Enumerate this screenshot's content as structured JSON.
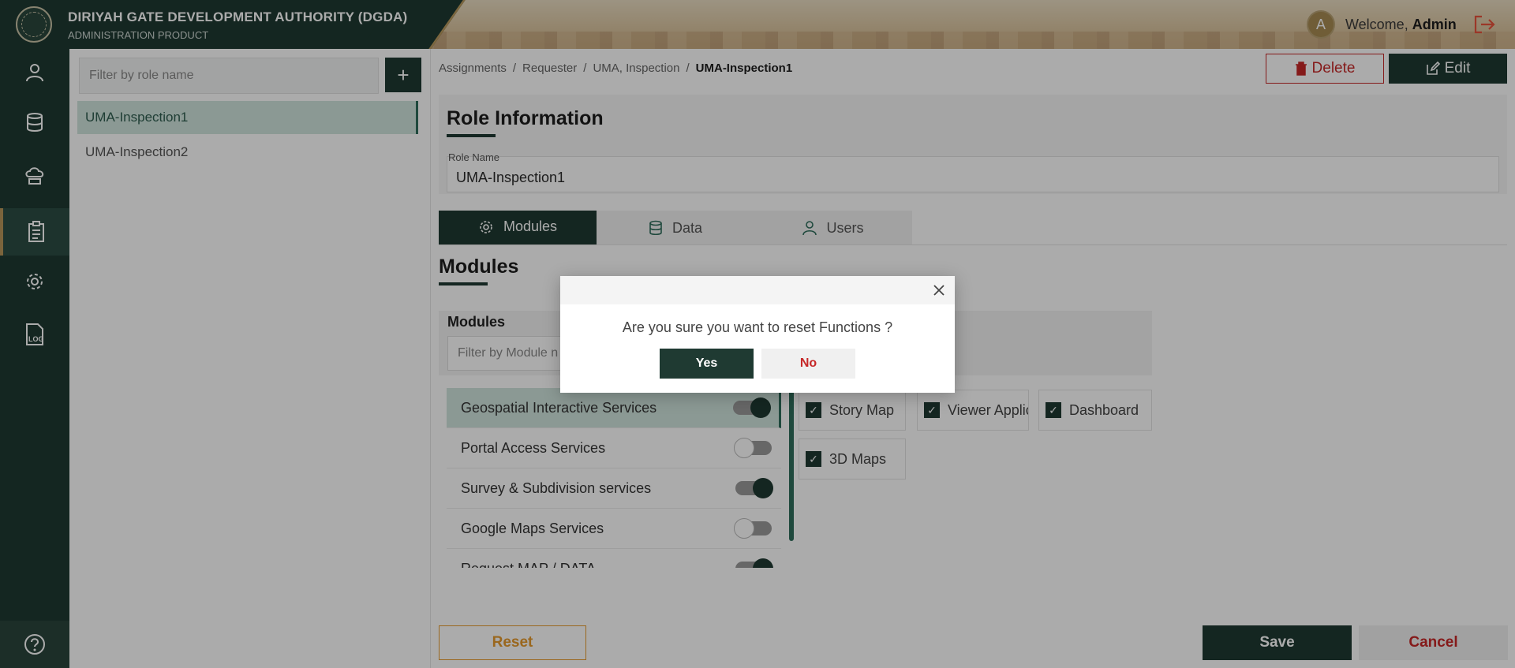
{
  "header": {
    "org_title": "DIRIYAH GATE DEVELOPMENT AUTHORITY (DGDA)",
    "org_subtitle": "ADMINISTRATION PRODUCT",
    "avatar_letter": "A",
    "welcome_prefix": "Welcome,",
    "welcome_user": "Admin"
  },
  "rail": {
    "items": [
      "user-icon",
      "database-icon",
      "cloud-icon",
      "clipboard-icon",
      "gear-icon",
      "log-icon"
    ],
    "active_index": 3,
    "help_icon": "help-icon"
  },
  "roles": {
    "filter_placeholder": "Filter by role name",
    "add_label": "+",
    "items": [
      "UMA-Inspection1",
      "UMA-Inspection2"
    ],
    "selected": "UMA-Inspection1"
  },
  "breadcrumb": [
    "Assignments",
    "Requester",
    "UMA, Inspection",
    "UMA-Inspection1"
  ],
  "actions": {
    "delete": "Delete",
    "edit": "Edit"
  },
  "role_info": {
    "title": "Role Information",
    "role_name_label": "Role Name",
    "role_name_value": "UMA-Inspection1"
  },
  "tabs": [
    {
      "label": "Modules",
      "icon": "gear-icon",
      "active": true
    },
    {
      "label": "Data",
      "icon": "database-icon",
      "active": false
    },
    {
      "label": "Users",
      "icon": "user-icon",
      "active": false
    }
  ],
  "modules_section": {
    "title": "Modules",
    "list_header": "Modules",
    "filter_placeholder": "Filter by Module n",
    "items": [
      {
        "label": "Geospatial Interactive Services",
        "on": true,
        "selected": true
      },
      {
        "label": "Portal Access Services",
        "on": false,
        "selected": false
      },
      {
        "label": "Survey & Subdivision services",
        "on": true,
        "selected": false
      },
      {
        "label": "Google Maps Services",
        "on": false,
        "selected": false
      },
      {
        "label": "Request MAP / DATA",
        "on": true,
        "selected": false
      }
    ]
  },
  "functions": [
    {
      "label": "Story Map",
      "checked": true
    },
    {
      "label": "Viewer Application",
      "checked": true
    },
    {
      "label": "Dashboard",
      "checked": true
    },
    {
      "label": "3D Maps",
      "checked": true
    }
  ],
  "footer": {
    "reset": "Reset",
    "save": "Save",
    "cancel": "Cancel"
  },
  "dialog": {
    "message": "Are you sure you want to reset Functions ?",
    "yes": "Yes",
    "no": "No"
  },
  "colors": {
    "primary": "#1f3a32",
    "accent_gold": "#b8955a",
    "danger": "#c62828",
    "reset_orange": "#e69a2e",
    "selection_green": "#cfe4dd"
  }
}
